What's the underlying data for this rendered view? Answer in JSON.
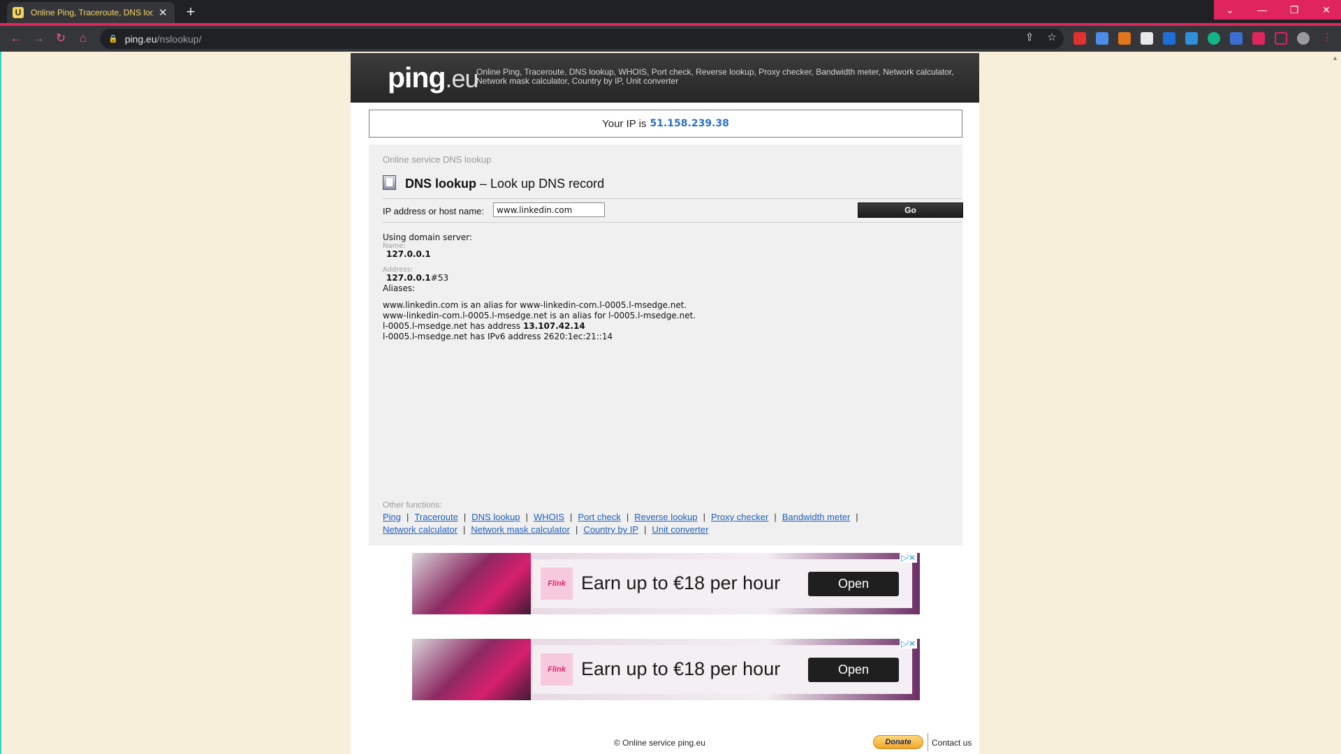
{
  "browser": {
    "tab_title": "Online Ping, Traceroute, DNS loo",
    "tab_favicon": "U",
    "new_tab": "+",
    "url_host": "ping.eu",
    "url_path": "/nslookup/",
    "accent_color": "#e0245e"
  },
  "header": {
    "logo_main": "ping",
    "logo_tld": ".eu",
    "tagline": "Online Ping, Traceroute, DNS lookup, WHOIS, Port check, Reverse lookup, Proxy checker, Bandwidth meter, Network calculator, Network mask calculator, Country by IP, Unit converter"
  },
  "ip": {
    "prefix": "Your IP is",
    "value": "51.158.239.38"
  },
  "tool": {
    "service_label": "Online service DNS lookup",
    "title_bold": "DNS lookup",
    "title_rest": " – Look up DNS record",
    "input_label": "IP address or host name:",
    "input_value": "www.linkedin.com",
    "go_label": "Go"
  },
  "result": {
    "using_server": "Using domain server:",
    "name_label": "Name:",
    "name_value": "127.0.0.1",
    "address_label": "Address:",
    "address_value": "127.0.0.1",
    "address_port": "#53",
    "aliases_label": "Aliases:",
    "line1": "www.linkedin.com is an alias for www-linkedin-com.l-0005.l-msedge.net.",
    "line2": "www-linkedin-com.l-0005.l-msedge.net is an alias for l-0005.l-msedge.net.",
    "line3_text": "l-0005.l-msedge.net has address ",
    "line3_ip": "13.107.42.14",
    "line4": "l-0005.l-msedge.net has IPv6 address 2620:1ec:21::14"
  },
  "other_functions": {
    "label": "Other functions:",
    "links": [
      "Ping",
      "Traceroute",
      "DNS lookup",
      "WHOIS",
      "Port check",
      "Reverse lookup",
      "Proxy checker",
      "Bandwidth meter",
      "Network calculator",
      "Network mask calculator",
      "Country by IP",
      "Unit converter"
    ]
  },
  "ads": [
    {
      "brand": "Flink",
      "headline": "Earn up to €18 per hour",
      "button": "Open",
      "ad_choice": "▷ˡ✕"
    },
    {
      "brand": "Flink",
      "headline": "Earn up to €18 per hour",
      "button": "Open",
      "ad_choice": "▷ˡ✕"
    }
  ],
  "footer": {
    "copyright": "© Online service ping.eu",
    "donate": "Donate",
    "contact": "Contact us"
  }
}
